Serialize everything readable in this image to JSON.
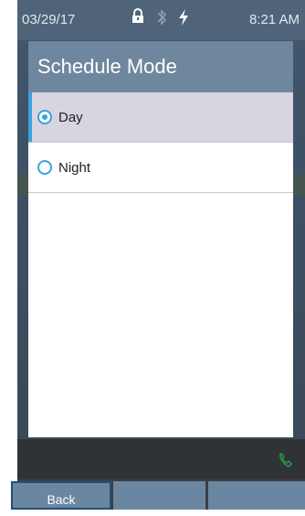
{
  "status_bar": {
    "date": "03/29/17",
    "time": "8:21 AM",
    "icons": [
      "lock-icon",
      "bluetooth-icon",
      "charging-bolt-icon"
    ]
  },
  "dialog": {
    "title": "Schedule Mode",
    "options": [
      {
        "label": "Day",
        "selected": true
      },
      {
        "label": "Night",
        "selected": false
      }
    ]
  },
  "bottom_bar": {
    "icon": "phone-icon"
  },
  "softkeys": {
    "back_label": "Back",
    "key2_label": "",
    "key3_label": ""
  },
  "colors": {
    "accent": "#39a3dc",
    "title_bar": "#6f879e",
    "selected_row": "#d8d4e0",
    "softkey": "#6b86a1"
  }
}
